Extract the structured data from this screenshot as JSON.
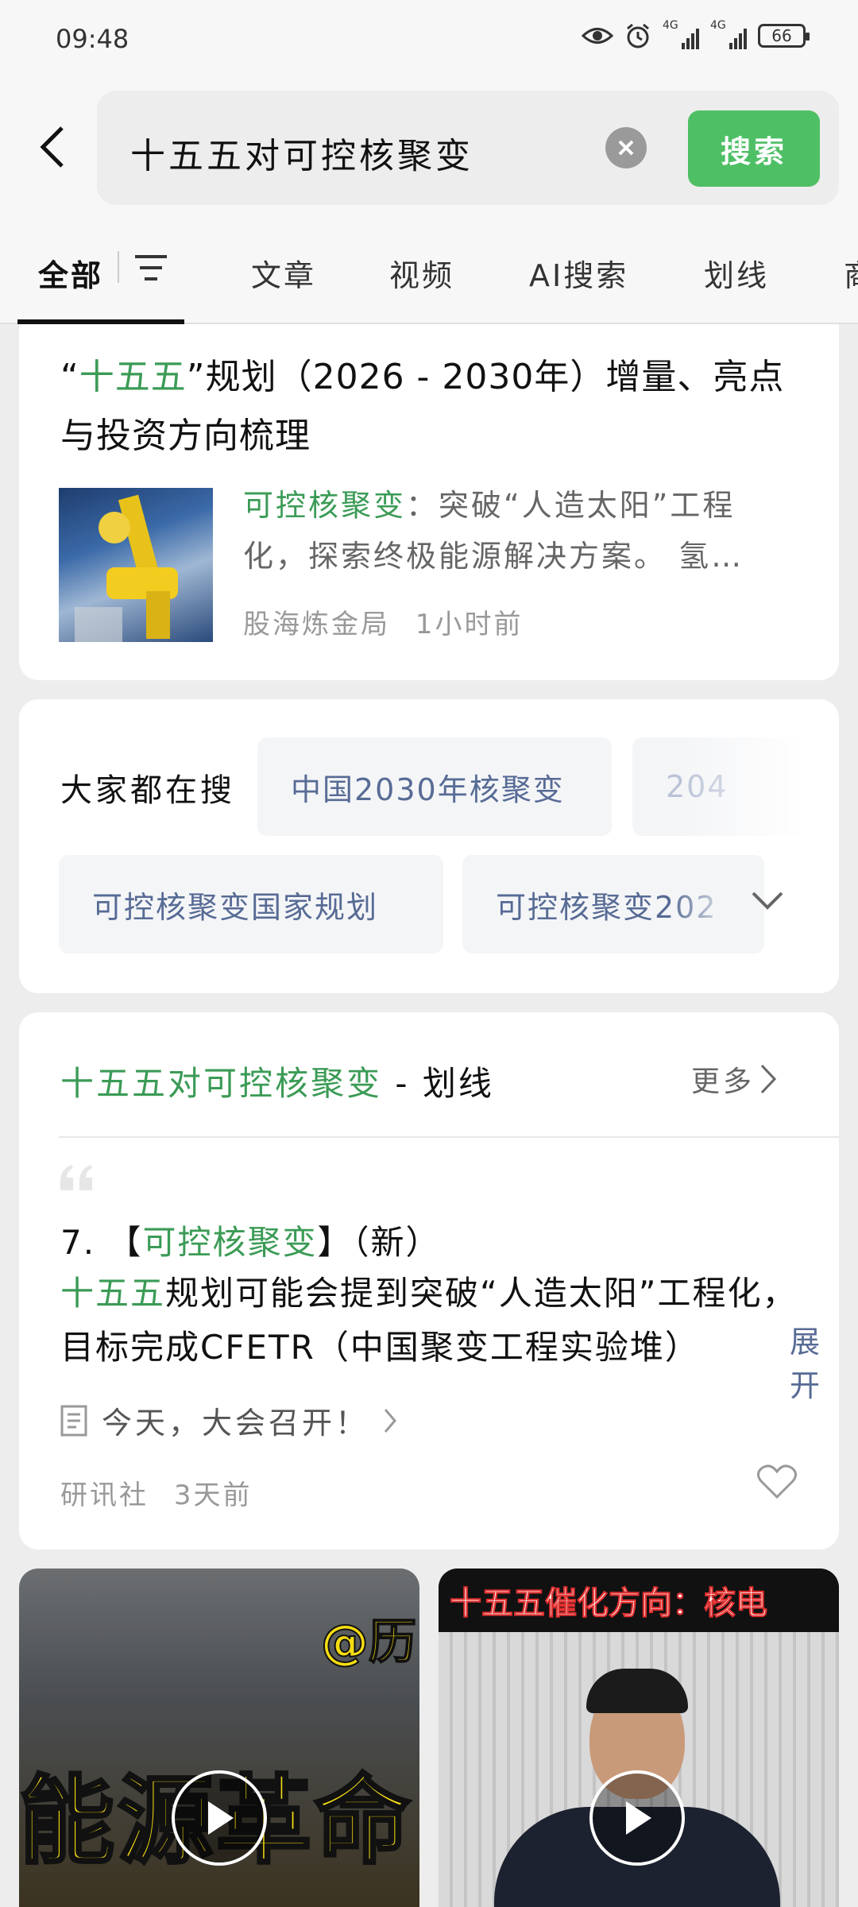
{
  "status_bar": {
    "time": "09:48",
    "network_1": "4G",
    "network_2": "4G",
    "battery": "66"
  },
  "search": {
    "query": "十五五对可控核聚变",
    "button_label": "搜索"
  },
  "tabs": [
    {
      "label": "全部",
      "active": true
    },
    {
      "label": "文章"
    },
    {
      "label": "视频"
    },
    {
      "label": "AI搜索"
    },
    {
      "label": "划线"
    },
    {
      "label": "商"
    }
  ],
  "article": {
    "title_quote_open": "“",
    "title_highlight": "十五五",
    "title_rest": "”规划（2026 - 2030年）增量、亮点与投资方向梳理",
    "snippet_highlight": "可控核聚变",
    "snippet_rest": "：突破“人造太阳”工程化，探索终极能源解决方案。 氢…",
    "source": "股海炼金局",
    "time": "1小时前"
  },
  "hot_searches": {
    "label": "大家都在搜",
    "items": [
      "中国2030年核聚变",
      "204",
      "可控核聚变国家规划",
      "可控核聚变202"
    ]
  },
  "highlights_section": {
    "title_highlight": "十五五对可控核聚变",
    "title_suffix": " - 划线",
    "more_label": "更多",
    "note_number": "7. 【",
    "note_tag": "可控核聚变",
    "note_tag_end": "】（新）",
    "body_highlight": "十五五",
    "body_rest": "规划可能会提到突破“人造太阳”工程化，目标完成CFETR（中国聚变工程实验堆）",
    "expand_label": "展开",
    "source_title": "今天，大会召开！",
    "author": "研讯社",
    "time": "3天前"
  },
  "videos": [
    {
      "caption": "能源革命",
      "badge": "@历"
    },
    {
      "caption": "十五五催化方向：核电"
    }
  ],
  "colors": {
    "accent_green": "#4fbf65",
    "highlight_green": "#3b9b56",
    "link_blue": "#576b95"
  }
}
